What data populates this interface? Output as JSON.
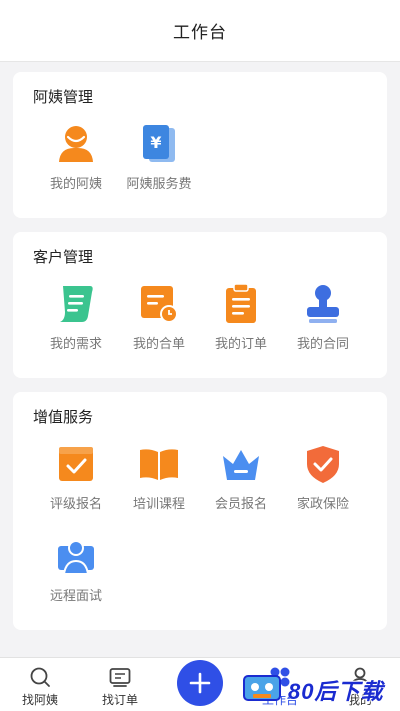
{
  "header": {
    "title": "工作台"
  },
  "sections": [
    {
      "title": "阿姨管理",
      "items": [
        {
          "label": "我的阿姨",
          "icon": "nanny-avatar-icon",
          "color": "#f5891d"
        },
        {
          "label": "阿姨服务费",
          "icon": "yuan-fee-icon",
          "color": "#3d86e0"
        }
      ]
    },
    {
      "title": "客户管理",
      "items": [
        {
          "label": "我的需求",
          "icon": "scroll-note-icon",
          "color": "#3bc48f"
        },
        {
          "label": "我的合单",
          "icon": "calendar-clock-icon",
          "color": "#f5891d"
        },
        {
          "label": "我的订单",
          "icon": "clipboard-icon",
          "color": "#f5891d"
        },
        {
          "label": "我的合同",
          "icon": "stamp-icon",
          "color": "#3d6ee0"
        }
      ]
    },
    {
      "title": "增值服务",
      "items": [
        {
          "label": "评级报名",
          "icon": "check-calendar-icon",
          "color": "#f5891d"
        },
        {
          "label": "培训课程",
          "icon": "open-book-icon",
          "color": "#f5891d"
        },
        {
          "label": "会员报名",
          "icon": "crown-icon",
          "color": "#4b8ef0"
        },
        {
          "label": "家政保险",
          "icon": "shield-check-icon",
          "color": "#f26b3a"
        },
        {
          "label": "远程面试",
          "icon": "video-interview-icon",
          "color": "#4b8ef0"
        }
      ]
    }
  ],
  "tabbar": {
    "items": [
      {
        "label": "找阿姨",
        "icon": "search-icon"
      },
      {
        "label": "找订单",
        "icon": "message-box-icon"
      },
      {
        "label": "工作台",
        "icon": "workbench-icon",
        "color": "#2f4fe6"
      },
      {
        "label": "我的",
        "icon": "user-icon"
      }
    ],
    "fab_icon": "plus-icon",
    "accent": "#2f4fe6"
  },
  "watermark": {
    "text": "80后下载"
  }
}
